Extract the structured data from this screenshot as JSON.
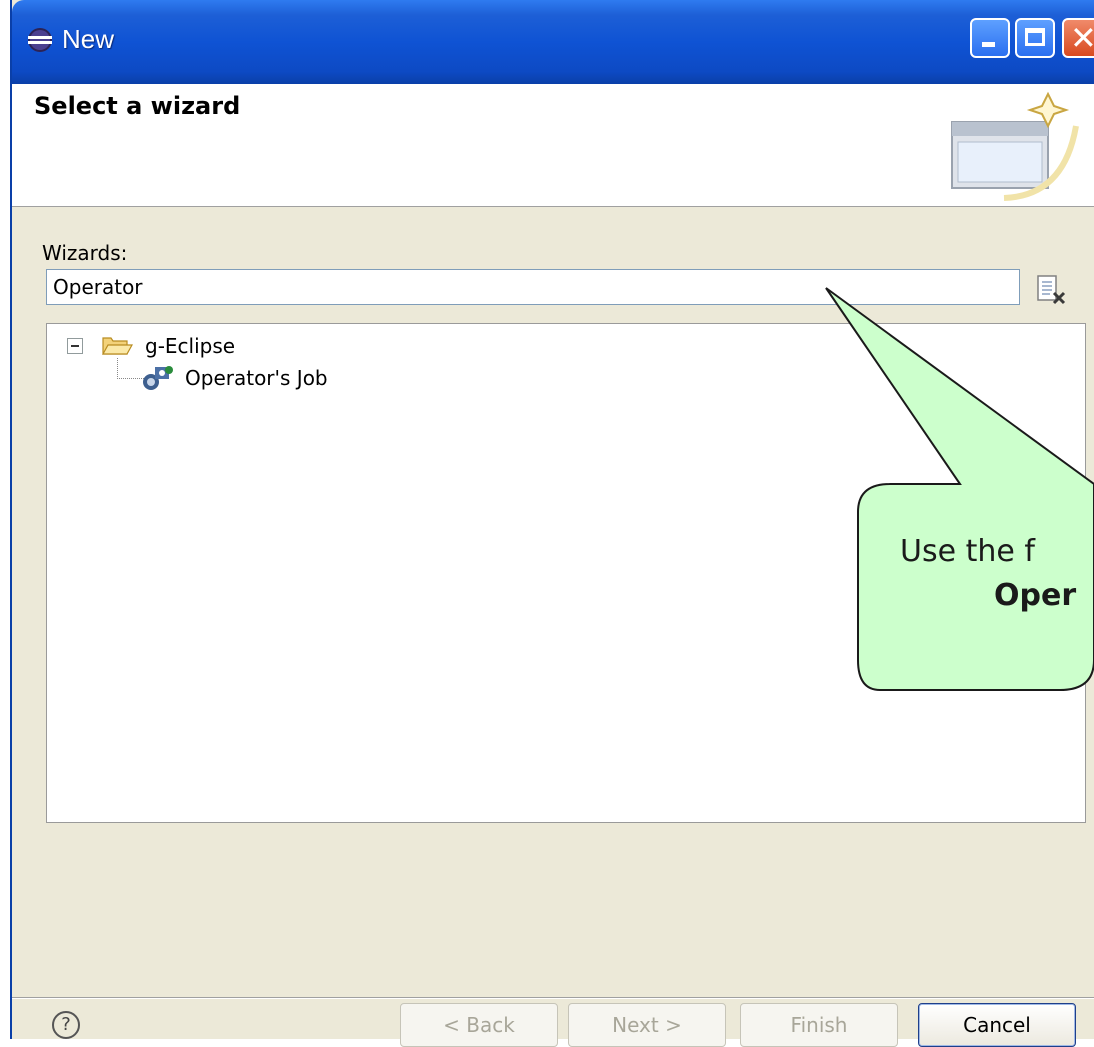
{
  "window": {
    "title": "New",
    "controls": {
      "minimize": "minimize-icon",
      "maximize": "maximize-icon",
      "close": "close-icon"
    }
  },
  "header": {
    "title": "Select a wizard",
    "banner_icon": "new-wizard-icon"
  },
  "wizards": {
    "label": "Wizards:",
    "filter_value": "Operator",
    "clear_icon": "clear-filter-icon"
  },
  "tree": {
    "items": [
      {
        "label": "g-Eclipse",
        "expanded": true,
        "icon": "folder-open-icon"
      },
      {
        "label": "Operator's Job",
        "icon": "job-icon"
      }
    ]
  },
  "callout": {
    "line1": "Use the f",
    "line2": "Oper"
  },
  "footer": {
    "help_icon": "help-icon",
    "back_label": "< Back",
    "next_label": "Next >",
    "finish_label": "Finish",
    "cancel_label": "Cancel"
  },
  "colors": {
    "titlebar": "#0f53d4",
    "callout_fill": "#ccffcc",
    "dialog_bg": "#ece9d8"
  }
}
